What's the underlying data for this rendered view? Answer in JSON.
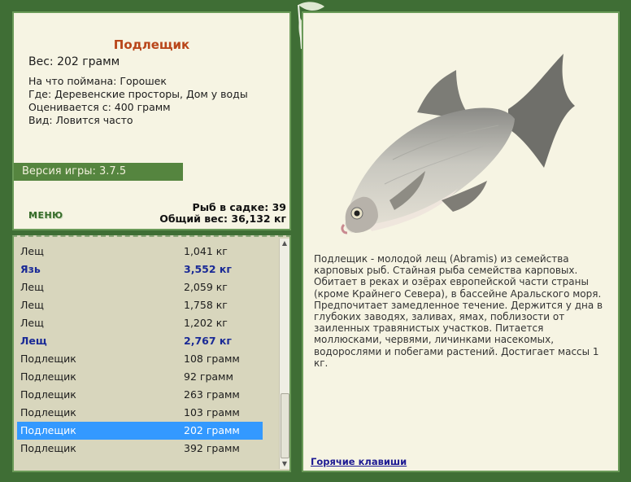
{
  "fish": {
    "name": "Подлещик",
    "weight_line": "Вес: 202 грамм",
    "details": [
      "На что поймана: Горошек",
      "Где: Деревенские просторы, Дом у воды",
      "Оценивается с: 400 грамм",
      "Вид: Ловится часто"
    ],
    "description": "Подлещик - молодой лещ (Abramis) из семейства карповых рыб. Стайная рыба семейства карповых. Обитает в реках и озёрах европейской части страны (кроме Крайнего Севера), в бассейне Аральского моря. Предпочитает замедленное течение. Держится у дна в глубоких заводях, заливах, ямах, поблизости от заиленных травянистых участков. Питается моллюсками, червями, личинками насекомых, водорослями и побегами растений. Достигает массы 1 кг."
  },
  "version": "Версия игры: 3.7.5",
  "menu_label": "МЕНЮ",
  "stats": {
    "count": "Рыб в садке: 39",
    "total": "Общий вес: 36,132 кг"
  },
  "catch_list": [
    {
      "name": "Лещ",
      "weight": "1,041 кг",
      "rare": false,
      "selected": false
    },
    {
      "name": "Язь",
      "weight": "3,552 кг",
      "rare": true,
      "selected": false
    },
    {
      "name": "Лещ",
      "weight": "2,059 кг",
      "rare": false,
      "selected": false
    },
    {
      "name": "Лещ",
      "weight": "1,758 кг",
      "rare": false,
      "selected": false
    },
    {
      "name": "Лещ",
      "weight": "1,202 кг",
      "rare": false,
      "selected": false
    },
    {
      "name": "Лещ",
      "weight": "2,767 кг",
      "rare": true,
      "selected": false
    },
    {
      "name": "Подлещик",
      "weight": "108 грамм",
      "rare": false,
      "selected": false
    },
    {
      "name": "Подлещик",
      "weight": "92 грамм",
      "rare": false,
      "selected": false
    },
    {
      "name": "Подлещик",
      "weight": "263 грамм",
      "rare": false,
      "selected": false
    },
    {
      "name": "Подлещик",
      "weight": "103 грамм",
      "rare": false,
      "selected": false
    },
    {
      "name": "Подлещик",
      "weight": "202 грамм",
      "rare": false,
      "selected": true
    },
    {
      "name": "Подлещик",
      "weight": "392 грамм",
      "rare": false,
      "selected": false
    }
  ],
  "hotkeys_label": "Горячие клавиши",
  "colors": {
    "background": "#3f6e35",
    "panel": "#f6f4e3",
    "list_panel": "#d8d6bd",
    "title": "#b9461a",
    "rare_fish": "#1a2a96",
    "selection": "#3399ff",
    "version_bar": "#55853f"
  }
}
